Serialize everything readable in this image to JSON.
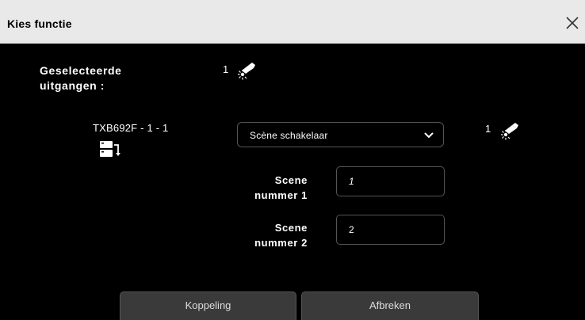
{
  "dialog": {
    "title": "Kies functie",
    "close_icon": "close-icon"
  },
  "selected_outputs": {
    "label_line1": "Geselecteerde",
    "label_line2": "uitgangen :",
    "count": "1",
    "icon": "light-bulb-icon"
  },
  "device": {
    "label": "TXB692F - 1 - 1",
    "icon": "module-link-icon",
    "function_select": {
      "value": "Scène schakelaar"
    },
    "count": "1",
    "icon_right": "light-bulb-icon"
  },
  "fields": {
    "scene1": {
      "label_line1": "Scene",
      "label_line2": "nummer 1",
      "value": "1"
    },
    "scene2": {
      "label_line1": "Scene",
      "label_line2": "nummer 2",
      "value": "2"
    }
  },
  "buttons": {
    "link": "Koppeling",
    "cancel": "Afbreken"
  },
  "colors": {
    "titlebar_bg": "#e9e9e9",
    "dialog_bg": "#000000",
    "button_bg": "#3a3a3a",
    "border": "#555555"
  }
}
